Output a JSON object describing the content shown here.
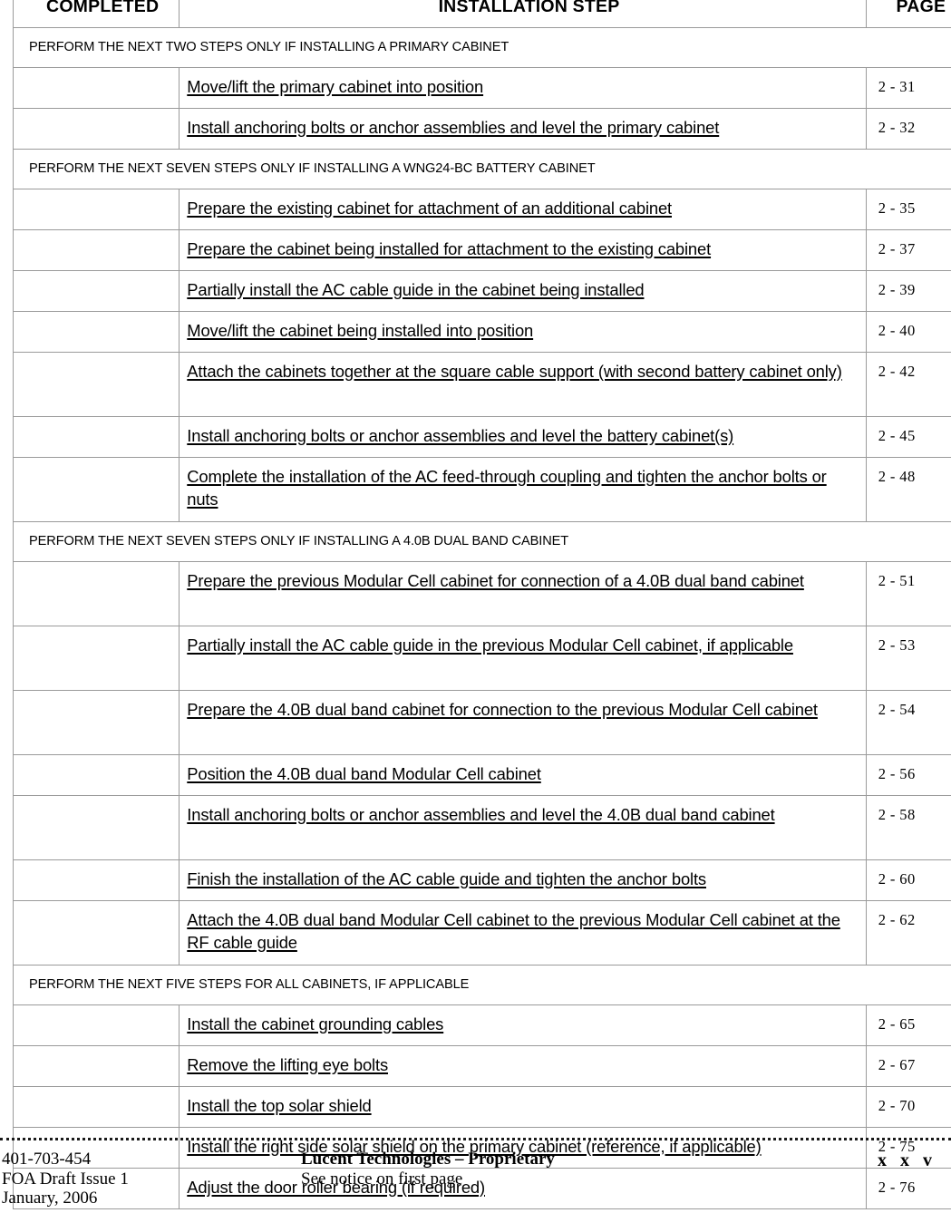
{
  "table": {
    "columns": [
      {
        "key": "completed",
        "label": "COMPLETED"
      },
      {
        "key": "step",
        "label": "INSTALLATION STEP"
      },
      {
        "key": "page",
        "label": "PAGE"
      }
    ],
    "sections": [
      {
        "banner": "PERFORM THE NEXT TWO STEPS ONLY IF INSTALLING A PRIMARY CABINET",
        "rows": [
          {
            "completed": "",
            "step": "Move/lift the primary cabinet into position",
            "page": "2 - 31",
            "lines": 1
          },
          {
            "completed": "",
            "step": "Install anchoring bolts or anchor assemblies and level the primary cabinet",
            "page": "2 - 32",
            "lines": 1
          }
        ]
      },
      {
        "banner": "PERFORM THE NEXT SEVEN STEPS ONLY IF INSTALLING A WNG24-BC BATTERY CABINET",
        "rows": [
          {
            "completed": "",
            "step": "Prepare the existing cabinet for attachment of an additional cabinet",
            "page": "2 - 35",
            "lines": 1
          },
          {
            "completed": "",
            "step": "Prepare the cabinet being installed for attachment to the existing cabinet",
            "page": "2 - 37",
            "lines": 1
          },
          {
            "completed": "",
            "step": "Partially install the AC cable guide in the cabinet being installed",
            "page": "2 - 39",
            "lines": 1
          },
          {
            "completed": "",
            "step": "Move/lift the cabinet being installed into position",
            "page": "2 - 40",
            "lines": 1
          },
          {
            "completed": "",
            "step": "Attach the cabinets together at the square cable support (with second battery cabinet only)",
            "page": "2 - 42",
            "lines": 2
          },
          {
            "completed": "",
            "step": "Install anchoring bolts or anchor assemblies and level the battery cabinet(s)",
            "page": "2 - 45",
            "lines": 1
          },
          {
            "completed": "",
            "step": "Complete the installation of the AC feed-through coupling and tighten the anchor bolts or nuts",
            "page": "2 - 48",
            "lines": 2
          }
        ]
      },
      {
        "banner": "PERFORM THE NEXT SEVEN STEPS ONLY IF INSTALLING A 4.0B DUAL BAND CABINET",
        "rows": [
          {
            "completed": "",
            "step": "Prepare the previous Modular Cell cabinet for connection of a 4.0B dual band cabinet",
            "page": "2 - 51",
            "lines": 2
          },
          {
            "completed": "",
            "step": "Partially install the AC cable guide in the previous Modular Cell cabinet, if applicable",
            "page": "2 - 53",
            "lines": 2
          },
          {
            "completed": "",
            "step": "Prepare the 4.0B dual band cabinet for connection to the previous Modular Cell cabinet",
            "page": "2 - 54",
            "lines": 2
          },
          {
            "completed": "",
            "step": "Position the 4.0B dual band Modular Cell cabinet",
            "page": "2 - 56",
            "lines": 1
          },
          {
            "completed": "",
            "step": "Install anchoring bolts or anchor assemblies and level the 4.0B dual band cabinet",
            "page": "2 - 58",
            "lines": 2
          },
          {
            "completed": "",
            "step": "Finish the installation of the AC cable guide and tighten the anchor bolts",
            "page": "2 - 60",
            "lines": 1
          },
          {
            "completed": "",
            "step": "Attach the 4.0B dual band Modular Cell cabinet to the previous Modular Cell cabinet at the RF cable guide",
            "page": "2 - 62",
            "lines": 2
          }
        ]
      },
      {
        "banner": "PERFORM THE NEXT FIVE STEPS FOR ALL CABINETS, IF APPLICABLE",
        "rows": [
          {
            "completed": "",
            "step": "Install the cabinet grounding cables",
            "page": "2 - 65",
            "lines": 1
          },
          {
            "completed": "",
            "step": "Remove the lifting eye bolts",
            "page": "2 - 67",
            "lines": 1
          },
          {
            "completed": "",
            "step": "Install the top solar shield",
            "page": "2 - 70",
            "lines": 1
          },
          {
            "completed": "",
            "step": "Install the right side solar shield on the primary cabinet (reference, if applicable)",
            "page": "2 - 75",
            "lines": 1
          },
          {
            "completed": "",
            "step": "Adjust the door roller bearing (if required)",
            "page": "2 - 76",
            "lines": 1
          }
        ]
      }
    ]
  },
  "footer": {
    "doc_number": "401-703-454",
    "issue": "FOA Draft Issue 1",
    "date": "January, 2006",
    "proprietary_line": "Lucent Technologies – Proprietary",
    "notice_line": "See notice on first page",
    "page_number": "x x v"
  }
}
